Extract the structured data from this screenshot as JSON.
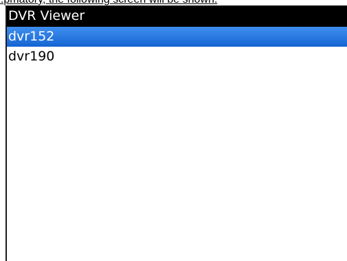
{
  "page": {
    "caption": "...pmatory, the following screen will be shown."
  },
  "app": {
    "title": "DVR Viewer"
  },
  "dvr_list": {
    "items": [
      {
        "label": "dvr152",
        "selected": true
      },
      {
        "label": "dvr190",
        "selected": false
      }
    ]
  },
  "colors": {
    "title_bar_bg": "#000000",
    "selection_bg": "#2a77e2",
    "selection_text": "#ffffff"
  }
}
